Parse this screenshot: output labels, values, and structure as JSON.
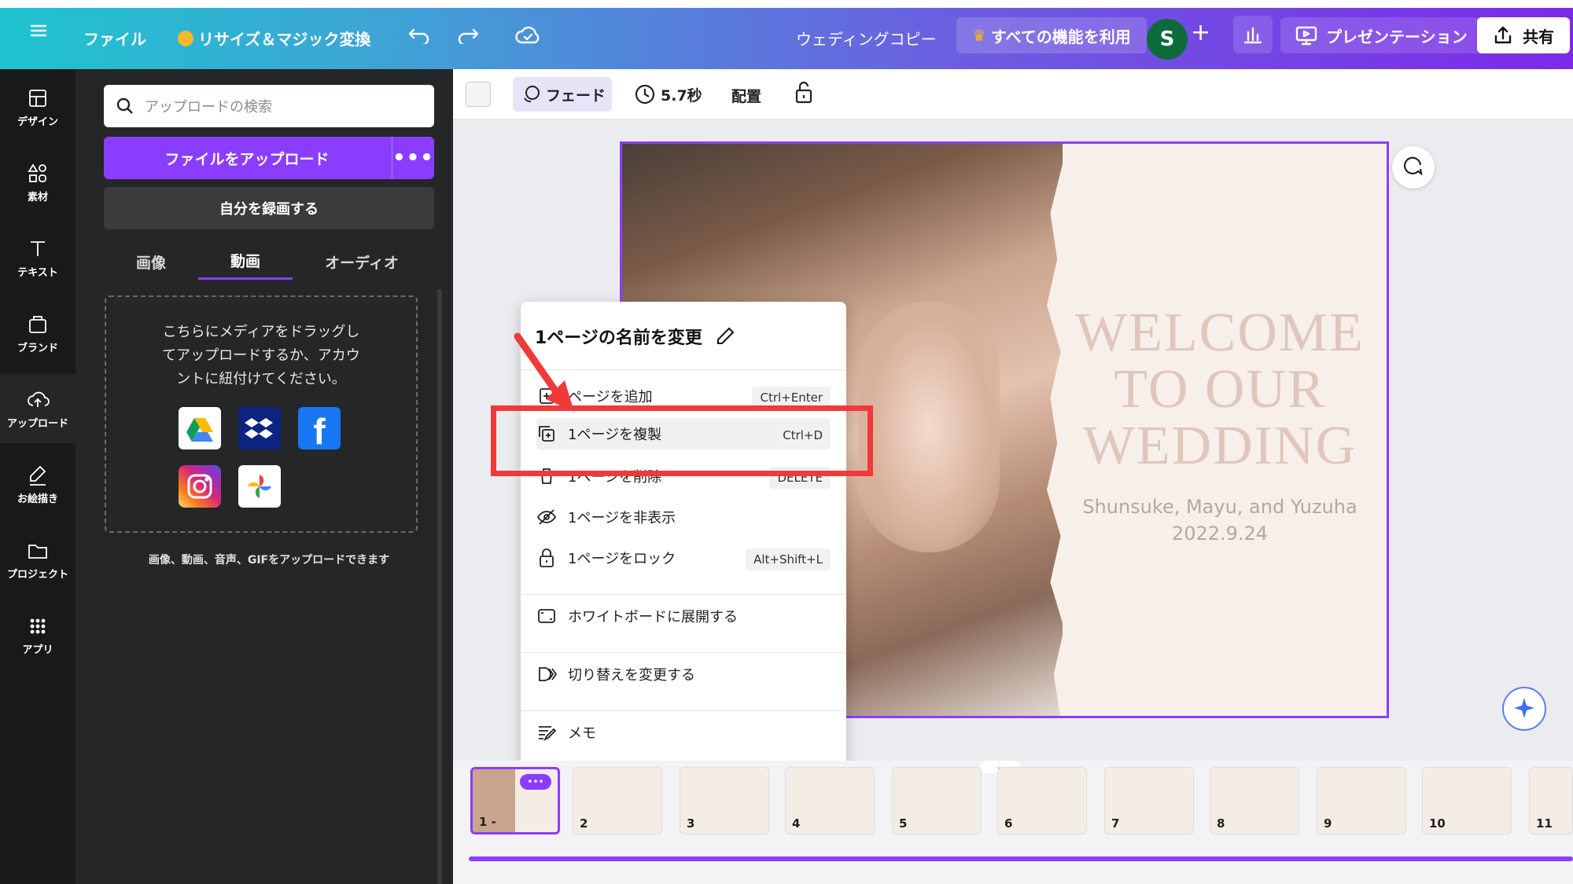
{
  "header": {
    "file": "ファイル",
    "resize": "リサイズ＆マジック変換",
    "doc_title": "ウェディングコピー",
    "pro": "すべての機能を利用",
    "avatar": "S",
    "present": "プレゼンテーション",
    "share": "共有"
  },
  "rail": {
    "items": [
      {
        "label": "デザイン"
      },
      {
        "label": "素材"
      },
      {
        "label": "テキスト"
      },
      {
        "label": "ブランド"
      },
      {
        "label": "アップロード"
      },
      {
        "label": "お絵描き"
      },
      {
        "label": "プロジェクト"
      },
      {
        "label": "アプリ"
      }
    ]
  },
  "panel": {
    "search_placeholder": "アップロードの検索",
    "upload_button": "ファイルをアップロード",
    "record_button": "自分を録画する",
    "tabs": [
      "画像",
      "動画",
      "オーディオ"
    ],
    "drop_text": [
      "こちらにメディアをドラッグし",
      "てアップロードするか、アカウ",
      "ントに紐付けてください。"
    ],
    "footer": "画像、動画、音声、GIFをアップロードできます"
  },
  "toolbar": {
    "fade": "フェード",
    "duration": "5.7秒",
    "arrange": "配置"
  },
  "slide": {
    "title_lines": [
      "WELCOME",
      "TO OUR",
      "WEDDING"
    ],
    "names": "Shunsuke, Mayu, and Yuzuha",
    "date": "2022.9.24"
  },
  "menu": {
    "title": "1ページの名前を変更",
    "items": [
      {
        "label": "ページを追加",
        "shortcut": "Ctrl+Enter"
      },
      {
        "label": "1ページを複製",
        "shortcut": "Ctrl+D"
      },
      {
        "label": "1ページを削除",
        "shortcut": "DELETE"
      },
      {
        "label": "1ページを非表示",
        "shortcut": ""
      },
      {
        "label": "1ページをロック",
        "shortcut": "Alt+Shift+L"
      },
      {
        "label": "ホワイトボードに展開する",
        "shortcut": ""
      },
      {
        "label": "切り替えを変更する",
        "shortcut": ""
      },
      {
        "label": "メモ",
        "shortcut": ""
      }
    ]
  },
  "thumbnails": [
    "1 -",
    "2",
    "3",
    "4",
    "5",
    "6",
    "7",
    "8",
    "9",
    "10",
    "11"
  ],
  "colors": {
    "accent": "#8b3dff",
    "highlight": "#f03a3a"
  }
}
